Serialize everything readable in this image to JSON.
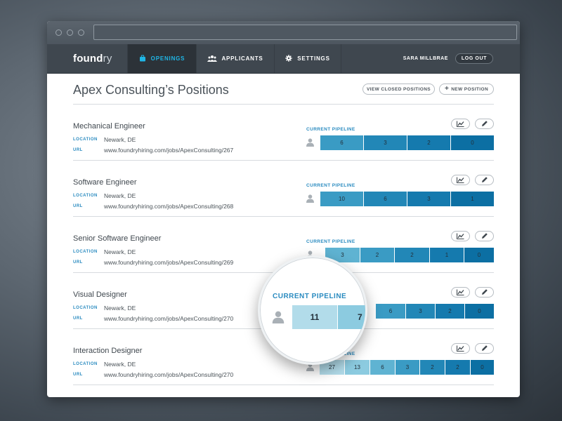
{
  "app": {
    "logo_bold": "found",
    "logo_light": "ry",
    "nav": [
      {
        "label": "OPENINGS",
        "icon": "briefcase-icon",
        "active": true
      },
      {
        "label": "APPLICANTS",
        "icon": "people-icon",
        "active": false
      },
      {
        "label": "SETTINGS",
        "icon": "gear-icon",
        "active": false
      }
    ],
    "user_name": "SARA MILLBRAE",
    "logout_label": "LOG OUT"
  },
  "page": {
    "title": "Apex Consulting’s Positions",
    "view_closed_label": "VIEW CLOSED POSITIONS",
    "new_position_label": "NEW POSITION"
  },
  "labels": {
    "location": "LOCATION",
    "url": "URL",
    "current_pipeline": "CURRENT PIPELINE"
  },
  "positions": [
    {
      "title": "Mechanical Engineer",
      "location": "Newark, DE",
      "url": "www.foundryhiring.com/jobs/ApexConsulting/267",
      "pipeline": [
        "6",
        "3",
        "2",
        "0"
      ]
    },
    {
      "title": "Software Engineer",
      "location": "Newark, DE",
      "url": "www.foundryhiring.com/jobs/ApexConsulting/268",
      "pipeline": [
        "10",
        "6",
        "3",
        "1"
      ]
    },
    {
      "title": "Senior Software Engineer",
      "location": "Newark, DE",
      "url": "www.foundryhiring.com/jobs/ApexConsulting/269",
      "pipeline": [
        "3",
        "2",
        "2",
        "1",
        "0"
      ]
    },
    {
      "title": "Visual Designer",
      "location": "Newark, DE",
      "url": "www.foundryhiring.com/jobs/ApexConsulting/270",
      "pipeline": [
        "11",
        "7",
        "6",
        "3",
        "2",
        "0"
      ]
    },
    {
      "title": "Interaction Designer",
      "location": "Newark, DE",
      "url": "www.foundryhiring.com/jobs/ApexConsulting/270",
      "pipeline": [
        "27",
        "13",
        "6",
        "3",
        "2",
        "2",
        "0"
      ]
    }
  ],
  "colors": {
    "accent": "#2a8bc0",
    "nav_active_text": "#1fb6e6",
    "pipeline_shades": [
      "#b2dcea",
      "#8ccbe0",
      "#5fb3d2",
      "#3a9bc4",
      "#2287b7",
      "#157aae",
      "#0c6fa3"
    ]
  }
}
